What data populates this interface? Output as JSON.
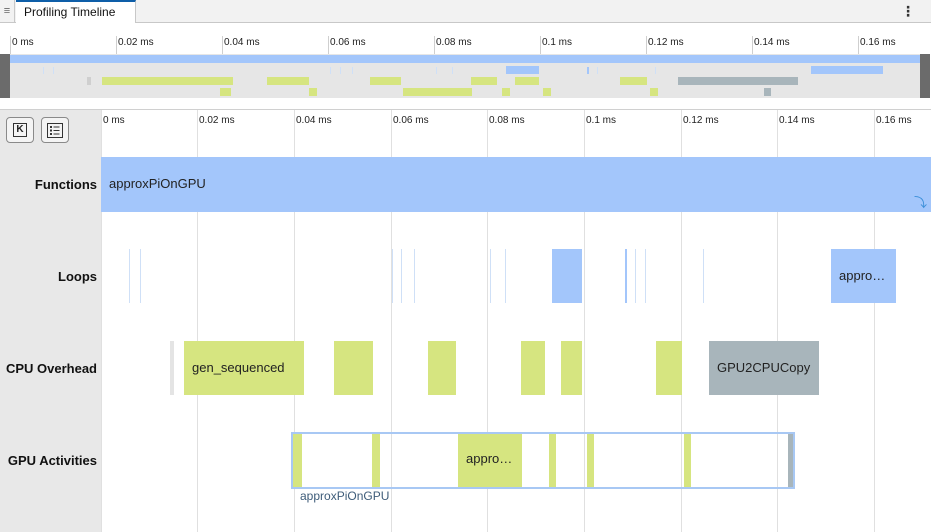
{
  "tab": {
    "menu_glyph": "≡",
    "title": "Profiling Timeline",
    "kebab": "⋮"
  },
  "overview": {
    "ticks": [
      "0 ms",
      "0.02 ms",
      "0.04 ms",
      "0.06 ms",
      "0.08 ms",
      "0.1 ms",
      "0.12 ms",
      "0.14 ms",
      "0.16 ms"
    ]
  },
  "toolbar": {
    "k_label": "K",
    "k_icon": "keyboard-shortcut-icon",
    "legend_icon": "legend-list-icon"
  },
  "axis": {
    "ticks": [
      "0 ms",
      "0.02 ms",
      "0.04 ms",
      "0.06 ms",
      "0.08 ms",
      "0.1 ms",
      "0.12 ms",
      "0.14 ms",
      "0.16 ms"
    ]
  },
  "rows": {
    "functions": {
      "label": "Functions"
    },
    "loops": {
      "label": "Loops"
    },
    "cpu": {
      "label": "CPU Overhead"
    },
    "gpu": {
      "label": "GPU Activities"
    }
  },
  "events": {
    "functions_main": "approxPiOnGPU",
    "loops_appro": "appro…",
    "cpu_gen": "gen_sequenced",
    "cpu_copy": "GPU2CPUCopy",
    "gpu_appro": "appro…",
    "gpu_group_label": "approxPiOnGPU"
  },
  "colors": {
    "function": "#a3c6fb",
    "cpu_kernel": "#d6e580",
    "memcopy": "#a8b5bb",
    "selection": "#a8c8f4",
    "tab_accent": "#0e5ea8"
  }
}
